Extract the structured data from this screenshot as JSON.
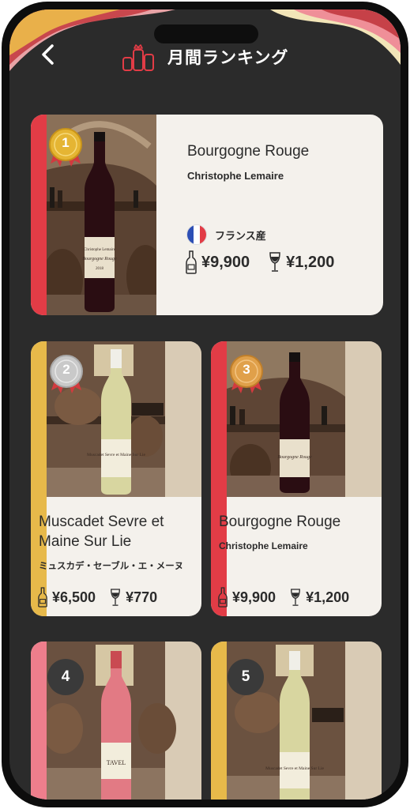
{
  "header": {
    "title": "月間ランキング",
    "back_icon": "chevron-left-icon",
    "title_icon": "wine-bottles-crown-icon"
  },
  "colors": {
    "background": "#2b2b2b",
    "card": "#f4f1ec",
    "rank1_stripe": "#e23c46",
    "rank2_stripe": "#e7b94a",
    "rank3_stripe": "#e23c46",
    "rank4_stripe": "#ee7e8c",
    "rank5_stripe": "#e7b94a",
    "gold": "#e5b533",
    "silver": "#c9c9c9",
    "bronze": "#e0a04a"
  },
  "rankings": [
    {
      "rank": "1",
      "name": "Bourgogne Rouge",
      "maker": "Christophe Lemaire",
      "country": "フランス産",
      "bottle_price": "¥9,900",
      "glass_price": "¥1,200",
      "bottle_label": "Christophe Lemaire",
      "bottle_sub": "Bourgogne Rouge",
      "vintage": "2018"
    },
    {
      "rank": "2",
      "name": "Muscadet Sevre et Maine Sur Lie",
      "maker": "ミュスカデ・セーブル・エ・メーヌ",
      "bottle_price": "¥6,500",
      "glass_price": "¥770",
      "bottle_label": "Muscadet Sevre et Maine Sur Lie"
    },
    {
      "rank": "3",
      "name": "Bourgogne Rouge",
      "maker": "Christophe Lemaire",
      "bottle_price": "¥9,900",
      "glass_price": "¥1,200",
      "bottle_label": "Bourgogne Rouge"
    },
    {
      "rank": "4",
      "bottle_label": "TAVEL"
    },
    {
      "rank": "5",
      "bottle_label": "Muscadet Sevre et Maine Sur Lie"
    }
  ]
}
